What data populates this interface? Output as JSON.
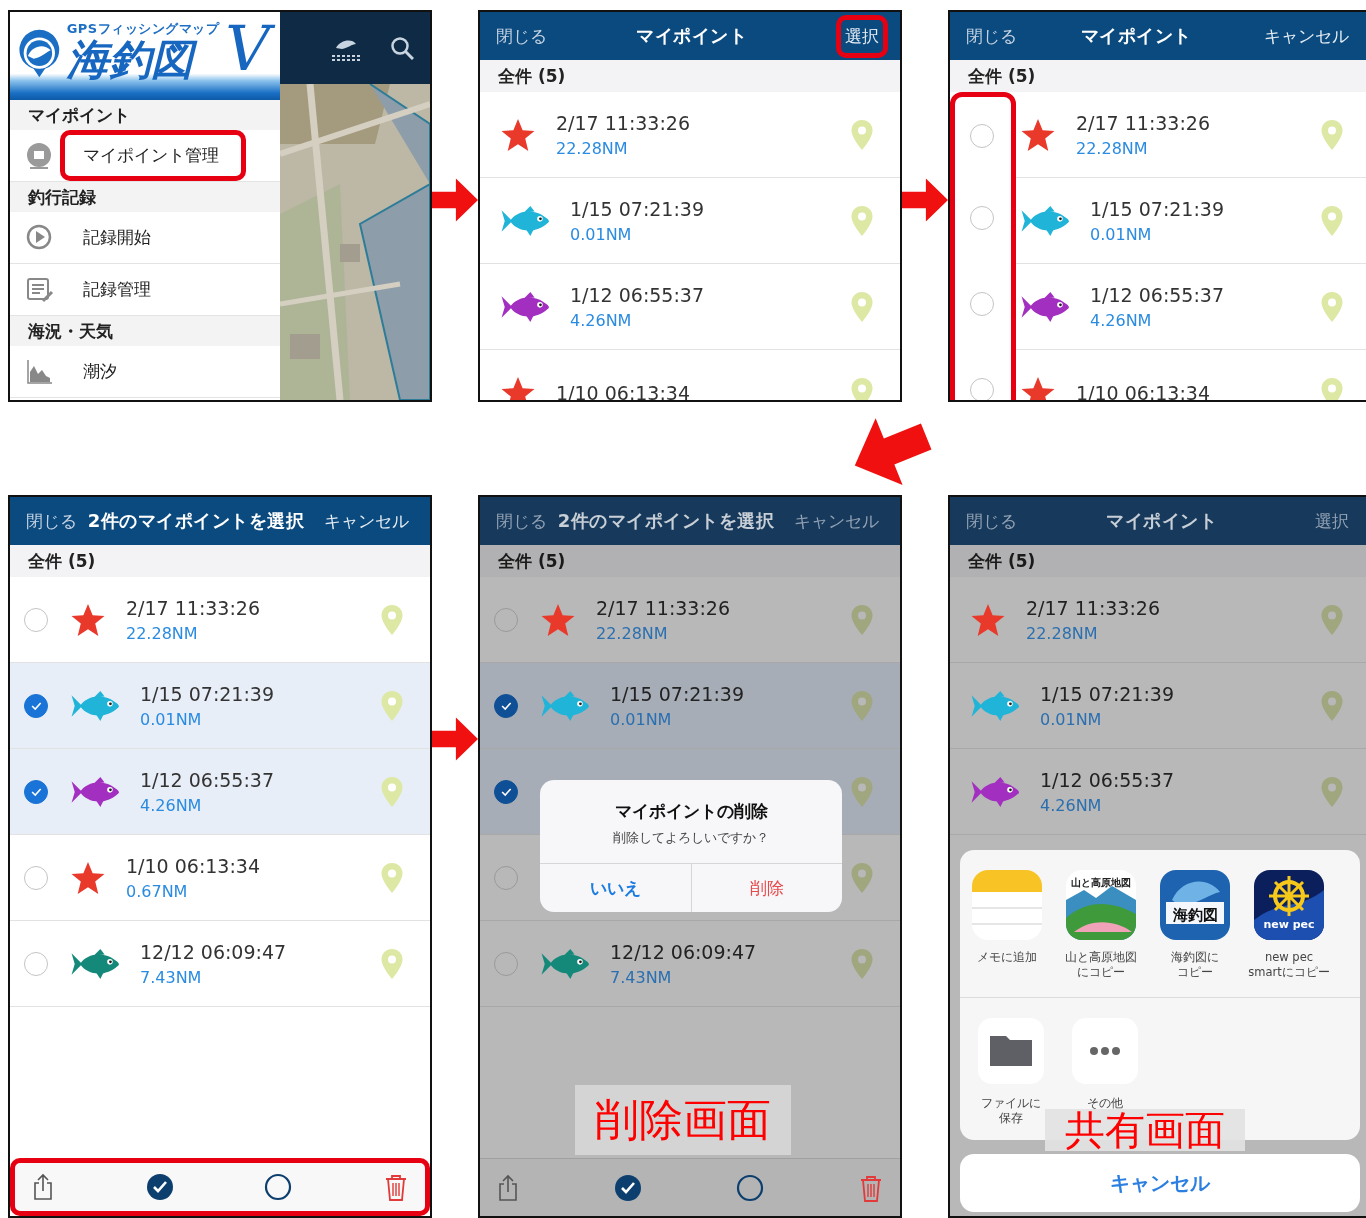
{
  "screens": [
    {
      "kind": "menu",
      "logo": {
        "caption": "GPSフィッシングマップ",
        "title": "海釣図",
        "mark": "V"
      },
      "menu": [
        {
          "kind": "section",
          "label": "マイポイント"
        },
        {
          "kind": "marker",
          "label": "マイポイント管理",
          "highlighted": true
        },
        {
          "kind": "section",
          "label": "釣行記録"
        },
        {
          "kind": "play",
          "label": "記録開始",
          "highlighted": false
        },
        {
          "kind": "list",
          "label": "記録管理",
          "highlighted": false
        },
        {
          "kind": "section",
          "label": "海況・天気"
        },
        {
          "kind": "tide",
          "label": "潮汐",
          "highlighted": false
        }
      ]
    },
    {
      "kind": "list",
      "dimmed": false,
      "header": {
        "left": "閉じる",
        "title": "マイポイント",
        "right": "選択",
        "right_highlighted": true
      },
      "section": "全件 (5)",
      "rows": [
        {
          "kind": "star",
          "color": "#e8392b",
          "time": "2/17 11:33:26",
          "distance": "22.28NM"
        },
        {
          "kind": "fish",
          "color": "#1fb4d8",
          "time": "1/15 07:21:39",
          "distance": "0.01NM"
        },
        {
          "kind": "fish",
          "color": "#a32fc0",
          "time": "1/12 06:55:37",
          "distance": "4.26NM"
        },
        {
          "kind": "star",
          "color": "#e8392b",
          "time": "1/10 06:13:34"
        }
      ]
    },
    {
      "kind": "list",
      "dimmed": false,
      "header": {
        "left": "閉じる",
        "title": "マイポイント",
        "right": "キャンセル",
        "right_highlighted": false
      },
      "section": "全件 (5)",
      "checkbox_column_highlighted": true,
      "rows": [
        {
          "checked": false,
          "kind": "star",
          "color": "#e8392b",
          "time": "2/17 11:33:26",
          "distance": "22.28NM"
        },
        {
          "checked": false,
          "kind": "fish",
          "color": "#1fb4d8",
          "time": "1/15 07:21:39",
          "distance": "0.01NM"
        },
        {
          "checked": false,
          "kind": "fish",
          "color": "#a32fc0",
          "time": "1/12 06:55:37",
          "distance": "4.26NM"
        },
        {
          "checked": false,
          "kind": "star",
          "color": "#e8392b",
          "time": "1/10 06:13:34"
        }
      ]
    },
    {
      "kind": "list",
      "dimmed": false,
      "header": {
        "left": "閉じる",
        "title": "2件のマイポイントを選択",
        "right": "キャンセル",
        "right_highlighted": false
      },
      "section": "全件 (5)",
      "toolbar": {
        "highlighted": true
      },
      "rows": [
        {
          "checked": false,
          "kind": "star",
          "color": "#e8392b",
          "time": "2/17 11:33:26",
          "distance": "22.28NM"
        },
        {
          "checked": true,
          "kind": "fish",
          "color": "#1fb4d8",
          "time": "1/15 07:21:39",
          "distance": "0.01NM"
        },
        {
          "checked": true,
          "kind": "fish",
          "color": "#a32fc0",
          "time": "1/12 06:55:37",
          "distance": "4.26NM"
        },
        {
          "checked": false,
          "kind": "star",
          "color": "#e8392b",
          "time": "1/10 06:13:34",
          "distance": "0.67NM"
        },
        {
          "checked": false,
          "kind": "fish",
          "color": "#14897a",
          "time": "12/12 06:09:47",
          "distance": "7.43NM"
        }
      ]
    },
    {
      "kind": "list",
      "dimmed": true,
      "header": {
        "left": "閉じる",
        "title": "2件のマイポイントを選択",
        "right": "キャンセル",
        "right_highlighted": false
      },
      "section": "全件 (5)",
      "toolbar": {
        "highlighted": false
      },
      "rows": [
        {
          "checked": false,
          "kind": "star",
          "color": "#e8392b",
          "time": "2/17 11:33:26",
          "distance": "22.28NM"
        },
        {
          "checked": true,
          "kind": "fish",
          "color": "#1fb4d8",
          "time": "1/15 07:21:39",
          "distance": "0.01NM"
        },
        {
          "checked": true
        },
        {
          "checked": false
        },
        {
          "checked": false,
          "kind": "fish",
          "color": "#14897a",
          "time": "12/12 06:09:47",
          "distance": "7.43NM"
        }
      ],
      "dialog": {
        "title": "マイポイントの削除",
        "message": "削除してよろしいですか？",
        "buttons": [
          {
            "label": "いいえ",
            "kind": "cancel"
          },
          {
            "label": "削除",
            "kind": "destructive"
          }
        ]
      },
      "caption": "削除画面"
    },
    {
      "kind": "list",
      "dimmed": true,
      "header": {
        "left": "閉じる",
        "title": "マイポイント",
        "right": "選択",
        "right_highlighted": false
      },
      "section": "全件 (5)",
      "rows": [
        {
          "kind": "star",
          "color": "#e8392b",
          "time": "2/17 11:33:26",
          "distance": "22.28NM"
        },
        {
          "kind": "fish",
          "color": "#1fb4d8",
          "time": "1/15 07:21:39",
          "distance": "0.01NM"
        },
        {
          "kind": "fish",
          "color": "#a32fc0",
          "time": "1/12 06:55:37",
          "distance": "4.26NM"
        }
      ],
      "share_sheet": {
        "apps": [
          {
            "kind": "notes",
            "label": [
              "メモに追加"
            ]
          },
          {
            "kind": "mountain",
            "icon_text": "山と高原地図",
            "label": [
              "山と高原地図",
              "にコピー"
            ]
          },
          {
            "kind": "fishing",
            "icon_text": "海釣図",
            "label": [
              "海釣図に",
              "コピー"
            ]
          },
          {
            "kind": "helm",
            "icon_text": "new pec",
            "label": [
              "new pec",
              "smartにコピー"
            ]
          }
        ],
        "actions": [
          {
            "kind": "folder",
            "label": [
              "ファイルに",
              "保存"
            ]
          },
          {
            "kind": "more",
            "label": [
              "その他"
            ]
          }
        ],
        "cancel": "キャンセル"
      },
      "caption": "共有画面"
    }
  ]
}
